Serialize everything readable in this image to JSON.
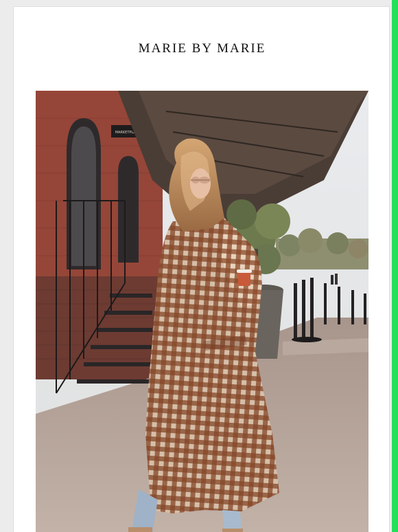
{
  "brand": {
    "name": "MARIE BY MARIE"
  },
  "hero_image": {
    "alt": "",
    "sign_text": "MARKETPLACE"
  },
  "colors": {
    "accent": "#22e05a",
    "card_background": "#ffffff",
    "page_background": "#ececec",
    "brand_text": "#111111"
  }
}
